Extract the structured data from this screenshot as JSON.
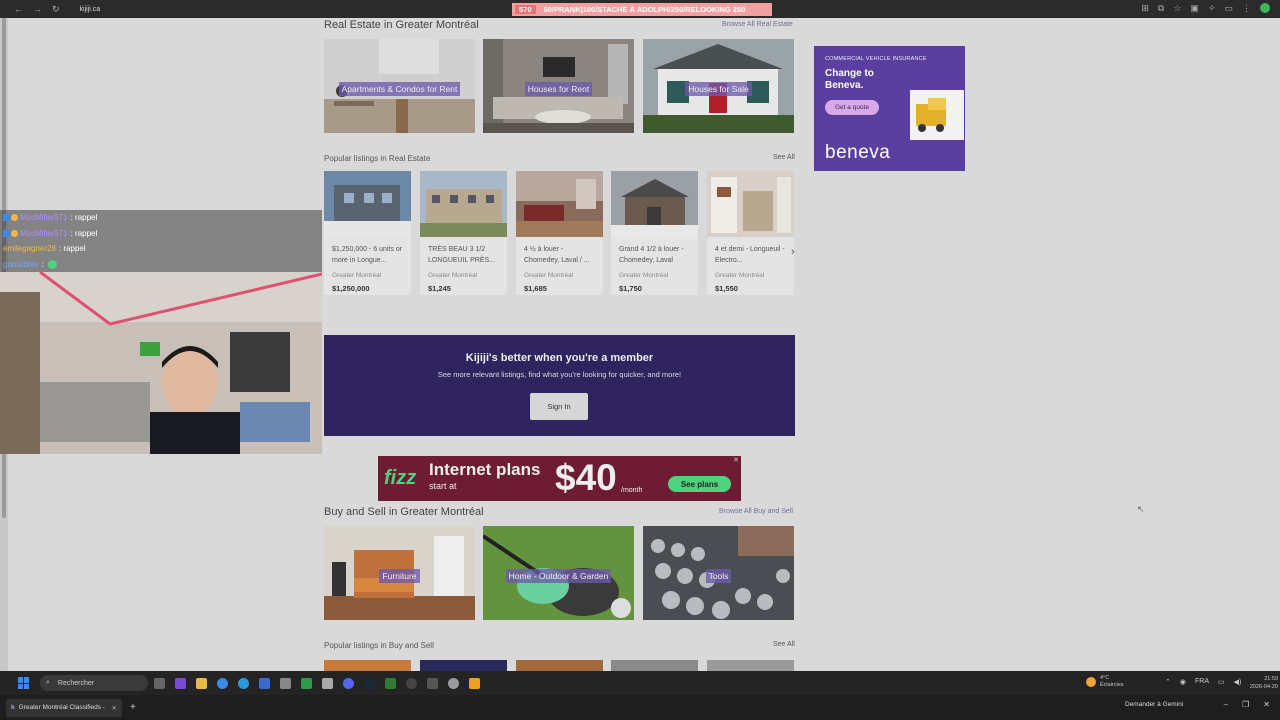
{
  "browser": {
    "url": "kijiji.ca",
    "ticker_count": "570",
    "ticker_text": "50/PRANK|100/STACHE À ADOLPH/250/RELOOKING 250",
    "nav_back": "←",
    "nav_forward": "→",
    "nav_reload": "↻"
  },
  "real_estate": {
    "title": "Real Estate in Greater Montréal",
    "browse_link": "Browse All Real Estate",
    "categories": [
      {
        "label": "Apartments & Condos for Rent"
      },
      {
        "label": "Houses for Rent"
      },
      {
        "label": "Houses for Sale"
      }
    ],
    "popular_title": "Popular listings in Real Estate",
    "see_all": "See All",
    "listings": [
      {
        "title": "$1,250,000 - 6 units or more in Longue...",
        "location": "Greater Montréal",
        "price": "$1,250,000"
      },
      {
        "title": "TRÈS BEAU 3 1/2 LONGUEUIL PRÈS...",
        "location": "Greater Montréal",
        "price": "$1,245"
      },
      {
        "title": "4 ½ à louer - Chomedey, Laval / ...",
        "location": "Greater Montréal",
        "price": "$1,685"
      },
      {
        "title": "Grand 4 1/2 à louer - Chomedey, Laval",
        "location": "Greater Montréal",
        "price": "$1,750"
      },
      {
        "title": "4 et demi - Longueuil - Electro...",
        "location": "Greater Montréal",
        "price": "$1,550"
      }
    ],
    "next_arrow": "›"
  },
  "member_banner": {
    "heading": "Kijiji's better when you're a member",
    "subtext": "See more relevant listings, find what you're looking for quicker, and more!",
    "button": "Sign In"
  },
  "fizz_ad": {
    "logo": "fizz",
    "headline": "Internet plans",
    "start": "start at",
    "price": "$40",
    "per": "/month",
    "button": "See plans",
    "close": "✕"
  },
  "beneva_ad": {
    "tag": "COMMERCIAL VEHICLE INSURANCE",
    "headline_1": "Change to",
    "headline_2": "Beneva.",
    "button": "Get a quote",
    "brand": "beneva"
  },
  "buy_sell": {
    "title": "Buy and Sell in Greater Montréal",
    "browse_link": "Browse All Buy and Sell",
    "categories": [
      {
        "label": "Furniture"
      },
      {
        "label": "Home - Outdoor & Garden"
      },
      {
        "label": "Tools"
      }
    ],
    "popular_title": "Popular listings in Buy and Sell",
    "see_all": "See All"
  },
  "chat": [
    {
      "user": "MacMiller971",
      "msg": ": rappel",
      "color": "#b38cff",
      "badges": true
    },
    {
      "user": "MacMiller971",
      "msg": ": rappel",
      "color": "#b38cff",
      "badges": true
    },
    {
      "user": "emilegagner28",
      "msg": ": rappel",
      "color": "#f0b64a",
      "badges": false
    },
    {
      "user": "grandbleu",
      "msg": ":",
      "color": "#6fa8ff",
      "badges": false
    }
  ],
  "taskbar": {
    "search": "Rechercher",
    "weather_temp": "4°C",
    "weather_desc": "Éclaircies",
    "lang": "FRA",
    "time": "21:59",
    "date": "2026-04-20"
  },
  "tabbar": {
    "tab_title": "Greater Montréal Classifieds -",
    "gemini": "Demander à Gemini",
    "plus": "+"
  },
  "colors": {
    "member_bg": "#2f245e",
    "fizz_bg": "#6e1c33",
    "fizz_green": "#4fd27d",
    "beneva_bg": "#5a3fa0",
    "label_bg": "#6e5aaa"
  }
}
